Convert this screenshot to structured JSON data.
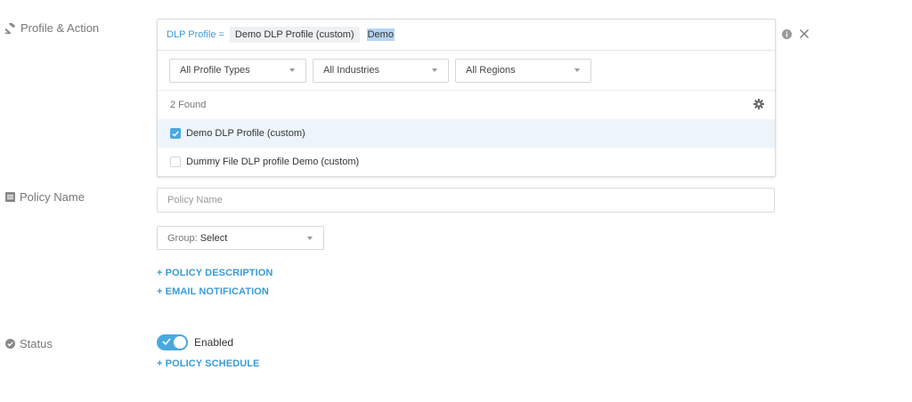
{
  "labels": {
    "profile_action": "Profile & Action",
    "policy_name": "Policy Name",
    "status": "Status"
  },
  "filter": {
    "key": "DLP Profile =",
    "chip": "Demo DLP Profile (custom)",
    "query": "Demo"
  },
  "dropdowns": {
    "profile_types": "All Profile Types",
    "industries": "All Industries",
    "regions": "All Regions"
  },
  "results": {
    "count_text": "2 Found",
    "items": [
      {
        "label": "Demo DLP Profile (custom)",
        "checked": true
      },
      {
        "label": "Dummy File DLP profile Demo (custom)",
        "checked": false
      }
    ]
  },
  "policy_name": {
    "placeholder": "Policy Name"
  },
  "group": {
    "prefix": "Group:",
    "value": "Select"
  },
  "links": {
    "policy_description": "+ POLICY DESCRIPTION",
    "email_notification": "+ EMAIL NOTIFICATION",
    "policy_schedule": "+ POLICY SCHEDULE"
  },
  "status": {
    "toggle_label": "Enabled",
    "enabled": true
  },
  "colors": {
    "accent": "#3a9bd5",
    "toggle": "#4aa8e0",
    "selected_row": "#edf5fb"
  },
  "icons": [
    "gavel-icon",
    "list-icon",
    "check-circle-icon",
    "info-icon",
    "close-icon",
    "gear-icon",
    "caret-down-icon"
  ]
}
